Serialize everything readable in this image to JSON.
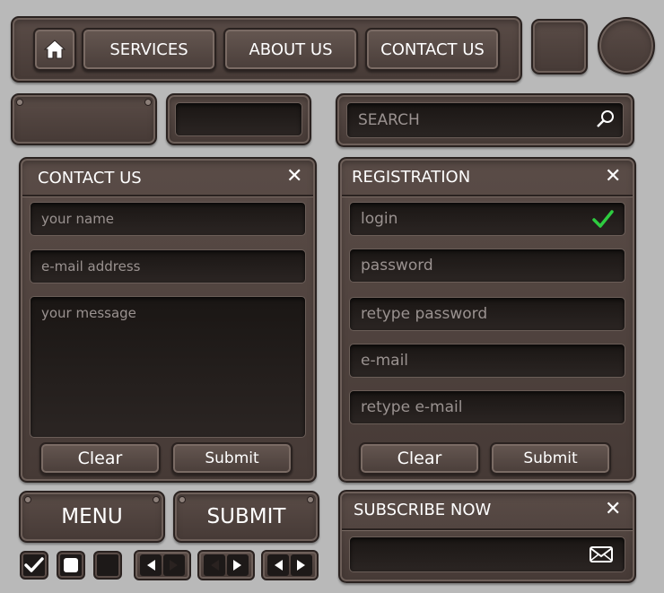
{
  "nav": {
    "items": [
      "SERVICES",
      "ABOUT US",
      "CONTACT US"
    ]
  },
  "search": {
    "placeholder": "SEARCH"
  },
  "contact_panel": {
    "title": "CONTACT US",
    "name_placeholder": "your name",
    "email_placeholder": "e-mail address",
    "message_placeholder": "your message",
    "clear_label": "Clear",
    "submit_label": "Submit"
  },
  "registration_panel": {
    "title": "REGISTRATION",
    "fields": [
      "login",
      "password",
      "retype password",
      "e-mail",
      "retype e-mail"
    ],
    "clear_label": "Clear",
    "submit_label": "Submit"
  },
  "bottom_buttons": {
    "menu_label": "MENU",
    "submit_label": "SUBMIT"
  },
  "subscribe": {
    "title": "SUBSCRIBE NOW"
  },
  "colors": {
    "check_green": "#2ecc40"
  }
}
